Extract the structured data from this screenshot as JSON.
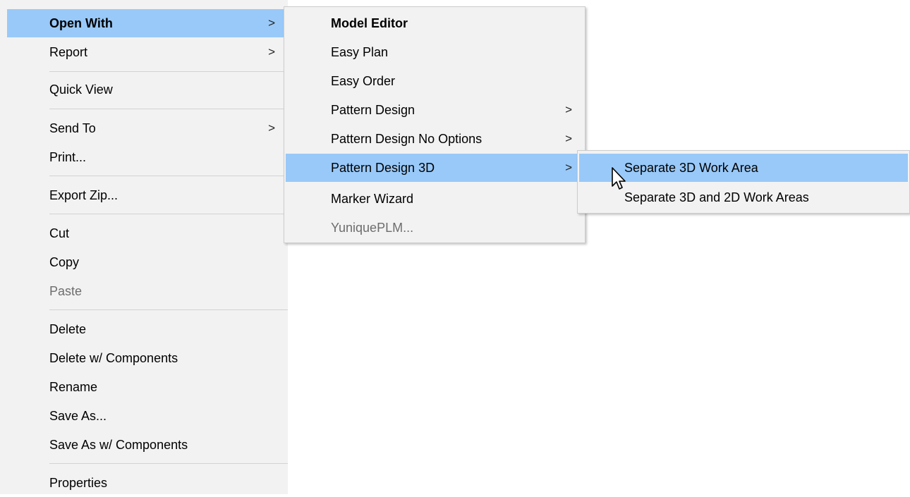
{
  "main_menu": {
    "items": [
      {
        "label": "Open With",
        "arrow": ">"
      },
      {
        "label": "Report",
        "arrow": ">"
      },
      {
        "label": "Quick View"
      },
      {
        "label": "Send To",
        "arrow": ">"
      },
      {
        "label": "Print..."
      },
      {
        "label": "Export Zip..."
      },
      {
        "label": "Cut"
      },
      {
        "label": "Copy"
      },
      {
        "label": "Paste"
      },
      {
        "label": "Delete"
      },
      {
        "label": "Delete w/ Components"
      },
      {
        "label": "Rename"
      },
      {
        "label": "Save As..."
      },
      {
        "label": "Save As w/ Components"
      },
      {
        "label": "Properties"
      }
    ]
  },
  "open_with_menu": {
    "items": [
      {
        "label": "Model Editor"
      },
      {
        "label": "Easy Plan"
      },
      {
        "label": "Easy Order"
      },
      {
        "label": "Pattern Design",
        "arrow": ">"
      },
      {
        "label": "Pattern Design No Options",
        "arrow": ">"
      },
      {
        "label": "Pattern Design 3D",
        "arrow": ">"
      },
      {
        "label": "Marker Wizard"
      },
      {
        "label": "YuniquePLM..."
      }
    ]
  },
  "pattern_design_3d_menu": {
    "items": [
      {
        "label": "Separate 3D Work Area"
      },
      {
        "label": "Separate 3D and 2D Work Areas"
      }
    ]
  },
  "colors": {
    "highlight": "#99c9f8",
    "menu_background": "#f2f2f2",
    "disabled_text": "#6d6d6d"
  },
  "icons": {
    "cursor": "mouse-pointer-icon"
  }
}
